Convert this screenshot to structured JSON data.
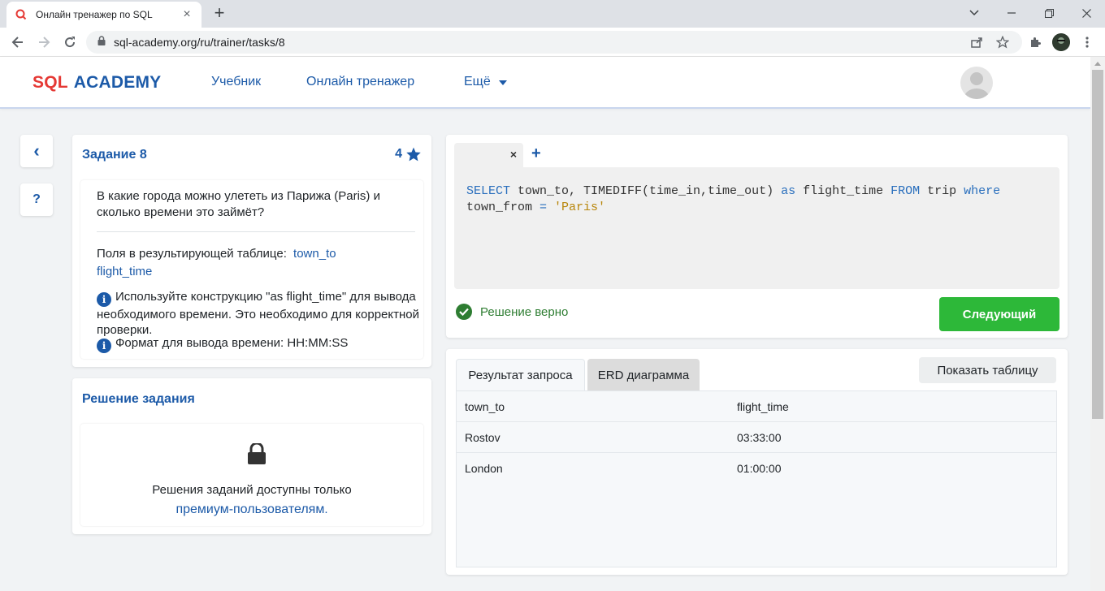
{
  "browser": {
    "tab_title": "Онлайн тренажер по SQL",
    "url": "sql-academy.org/ru/trainer/tasks/8"
  },
  "header": {
    "logo_sql": "SQL",
    "logo_academy": "ACADEMY",
    "nav": [
      "Учебник",
      "Онлайн тренажер",
      "Ещё"
    ]
  },
  "sidebar": {
    "back_label": "‹",
    "help_label": "?"
  },
  "task": {
    "title": "Задание 8",
    "points": "4",
    "question": "В какие города можно улететь из Парижа (Paris) и сколько времени это займёт?",
    "fields_label": "Поля в результирующей таблице:",
    "fields": [
      "town_to",
      "flight_time"
    ],
    "hints": [
      "Используйте конструкцию \"as flight_time\" для вывода необходимого времени. Это необходимо для корректной проверки.",
      "Формат для вывода времени: HH:MM:SS"
    ]
  },
  "solution": {
    "title": "Решение задания",
    "locked_text": "Решения заданий доступны только",
    "locked_link": "премиум-пользователям",
    "locked_suffix": "."
  },
  "editor": {
    "add_tab": "+",
    "close_tab": "×",
    "code_tokens": {
      "select": "SELECT",
      "l1a": " town_to, TIMEDIFF(time_in,time_out) ",
      "as": "as",
      "l1b": " flight_time ",
      "from": "FROM",
      "l1c": " trip ",
      "where": "where",
      "l2a": "town_from ",
      "eq": "=",
      "sp": " ",
      "str": "'Paris'"
    },
    "status": "Решение верно",
    "next_button": "Следующий"
  },
  "results": {
    "tabs": [
      "Результат запроса",
      "ERD диаграмма"
    ],
    "show_table": "Показать таблицу",
    "columns": [
      "town_to",
      "flight_time"
    ],
    "rows": [
      [
        "Rostov",
        "03:33:00"
      ],
      [
        "London",
        "01:00:00"
      ]
    ]
  },
  "colors": {
    "brand_blue": "#1c5aa8",
    "brand_red": "#e53935",
    "success_green": "#2db839"
  }
}
